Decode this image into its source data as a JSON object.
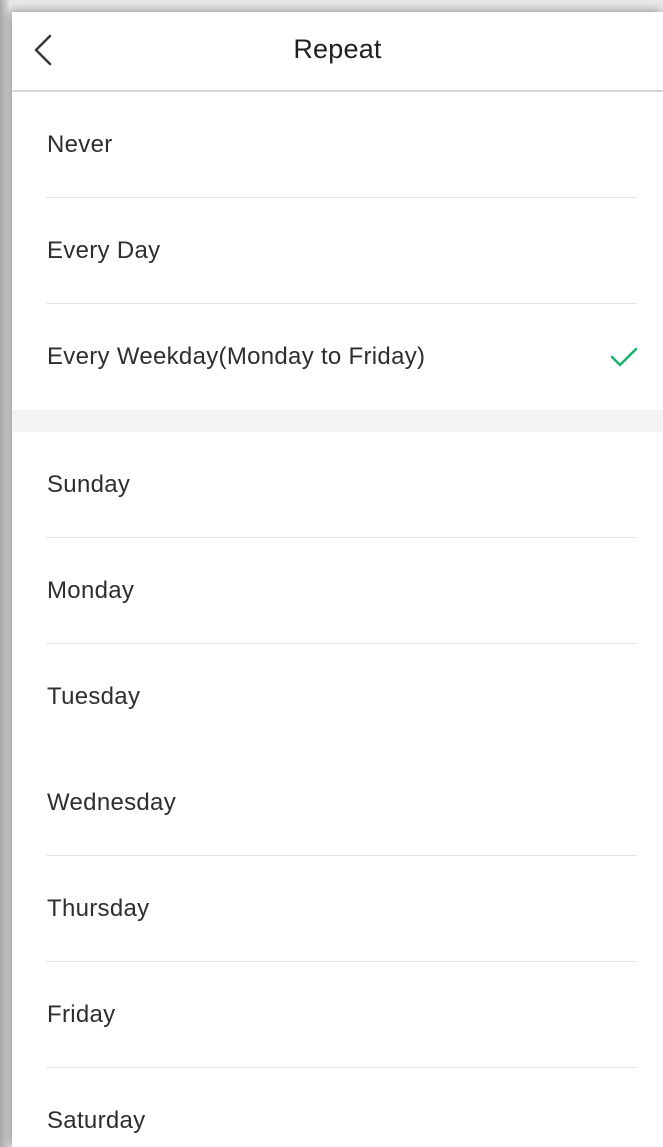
{
  "header": {
    "title": "Repeat",
    "back_icon": "chevron-left-icon"
  },
  "presets": [
    {
      "label": "Never",
      "selected": false
    },
    {
      "label": "Every Day",
      "selected": false
    },
    {
      "label": "Every Weekday(Monday to Friday)",
      "selected": true
    }
  ],
  "days": [
    {
      "label": "Sunday"
    },
    {
      "label": "Monday"
    },
    {
      "label": "Tuesday"
    },
    {
      "label": "Wednesday"
    },
    {
      "label": "Thursday"
    },
    {
      "label": "Friday"
    },
    {
      "label": "Saturday"
    }
  ],
  "colors": {
    "check": "#1fb36b"
  }
}
